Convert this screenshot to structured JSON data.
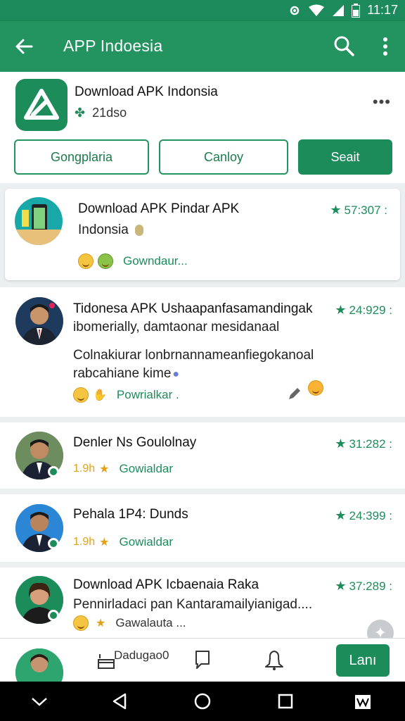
{
  "status_bar": {
    "time": "11:17"
  },
  "app_bar": {
    "title": "APP Indoesia"
  },
  "header": {
    "app_name": "Download APK Indonsia",
    "meta_text": "21dso",
    "buttons": [
      {
        "label": "Gongplaria"
      },
      {
        "label": "Canloy"
      },
      {
        "label": "Seait"
      }
    ]
  },
  "items": [
    {
      "title": "Download APK Pindar APK",
      "subtitle": "Indonsia",
      "rating": "57:307 :",
      "footer_label": "Gowndaur..."
    },
    {
      "title": "Tidonesa APK Ushaapanfasamandingak",
      "subtitle": "ibomerially, damtaonar mesidanaal",
      "description_line1": "Colnakiurar lonbrnannameanfiegokanoal",
      "description_line2": "rabcahiane kime",
      "rating": "24:929 :",
      "footer_label": "Powrialkar ."
    },
    {
      "title": "Denler Ns Goulolnay",
      "badge": "1.9h",
      "rating": "31:282 :",
      "footer_label": "Gowialdar"
    },
    {
      "title": "Pehala 1P4: Dunds",
      "badge": "1.9h",
      "rating": "24:399 :",
      "footer_label": "Gowialdar"
    },
    {
      "title": "Download APK Icbaenaia Raka",
      "subtitle": "Pennirladaci pan Kantaramailyianigad....",
      "rating": "37:289 :",
      "footer_label": "Gawalauta ..."
    }
  ],
  "bottom_nav": {
    "label": "Dadugao0",
    "action_button": "Lanı"
  },
  "colors": {
    "primary": "#1d8c5b",
    "app_bar": "#23935f",
    "status_bar": "#1c8a5a"
  }
}
